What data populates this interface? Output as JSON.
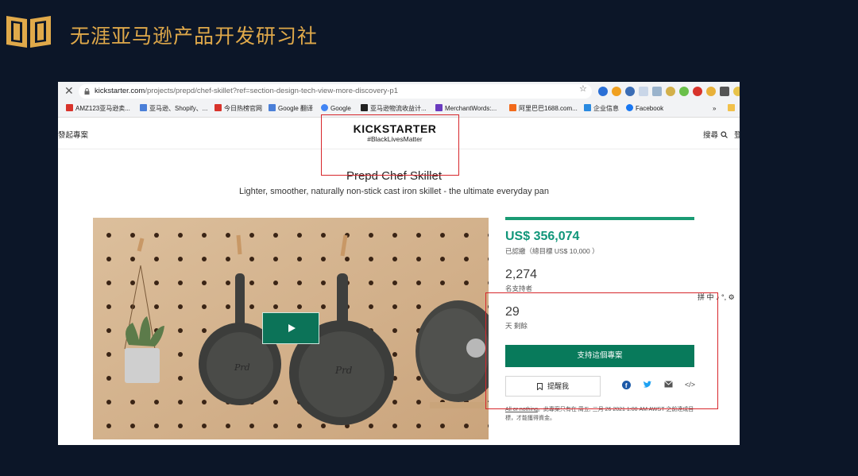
{
  "slide": {
    "title": "无涯亚马逊产品开发研习社",
    "accent_color": "#e0a94a",
    "background_color": "#0c1628",
    "logo_icon": "open-book-icon"
  },
  "browser": {
    "url_domain": "kickstarter.com",
    "url_path": "/projects/prepd/chef-skillet?ref=section-design-tech-view-more-discovery-p1",
    "bookmarks": [
      {
        "label": "AMZ123亚马逊卖...",
        "color": "#d8332b"
      },
      {
        "label": "亚马逊、Shopify、...",
        "color": "#4a7fd8"
      },
      {
        "label": "今日热榜官网",
        "color": "#d8332b"
      },
      {
        "label": "Google 翻译",
        "color": "#4a7fd8"
      },
      {
        "label": "Google",
        "color": "#4285f4"
      },
      {
        "label": "亚马逊物流收益计...",
        "color": "#222222"
      },
      {
        "label": "MerchantWords:...",
        "color": "#6a3bbf"
      },
      {
        "label": "阿里巴巴1688.com...",
        "color": "#f26a1b"
      },
      {
        "label": "企业信息",
        "color": "#2a8ae0"
      },
      {
        "label": "Facebook",
        "color": "#1877f2"
      }
    ],
    "bookmarks_overflow": "»"
  },
  "kickstarter": {
    "nav_start": "發起專案",
    "logo": "KICKSTARTER",
    "tagline": "#BlackLivesMatter",
    "nav_search": "搜尋",
    "nav_edge": "登",
    "project_title": "Prepd Chef Skillet",
    "project_subtitle": "Lighter, smoother, naturally non-stick cast iron skillet - the ultimate everyday pan",
    "pledged": "US$ 356,074",
    "pledged_note": "已認繳（總目標 US$ 10,000 ）",
    "funding_progress_percent": 100,
    "backers": "2,274",
    "backers_label": "名支持者",
    "days": "29",
    "days_label": "天 剩餘",
    "back_button": "支持這個專案",
    "remind_button": "提醒我",
    "all_or_nothing_link": "All or nothing",
    "all_or_nothing_text": "。此專案只有在 周五, 三月 26 2021 1:00 AM AWST 之前達成目標，才能獲得資金。",
    "ime_text": "拼 中 ♪ °, ⚙",
    "brand_color": "#087a5b"
  }
}
